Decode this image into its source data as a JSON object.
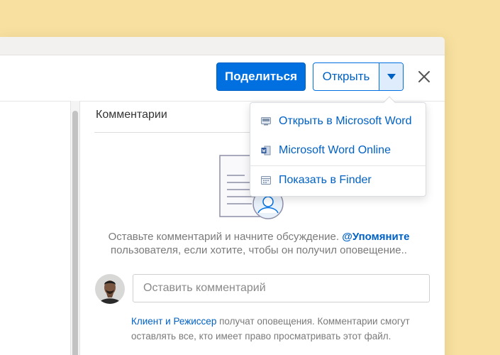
{
  "toolbar": {
    "share_label": "Поделиться",
    "open_label": "Открыть"
  },
  "dropdown": {
    "items": [
      {
        "label": "Открыть в Microsoft Word",
        "icon": "desktop-app-icon"
      },
      {
        "label": "Microsoft Word Online",
        "icon": "word-doc-icon"
      },
      {
        "label": "Показать в Finder",
        "icon": "finder-icon"
      }
    ]
  },
  "comments": {
    "title": "Комментарии",
    "empty_text_before": "Оставьте комментарий и начните обсуждение. ",
    "empty_mention": "@Упомяните",
    "empty_text_after": " пользователя, если хотите, чтобы он получил оповещение..",
    "input_placeholder": "Оставить комментарий",
    "notify_names": "Клиент и Режиссер",
    "notify_text": " получат оповещения. Комментарии смогут оставлять все, кто имеет право просматривать этот файл."
  },
  "colors": {
    "background": "#f7e0a0",
    "accent": "#0070e0",
    "link": "#0061c4"
  }
}
